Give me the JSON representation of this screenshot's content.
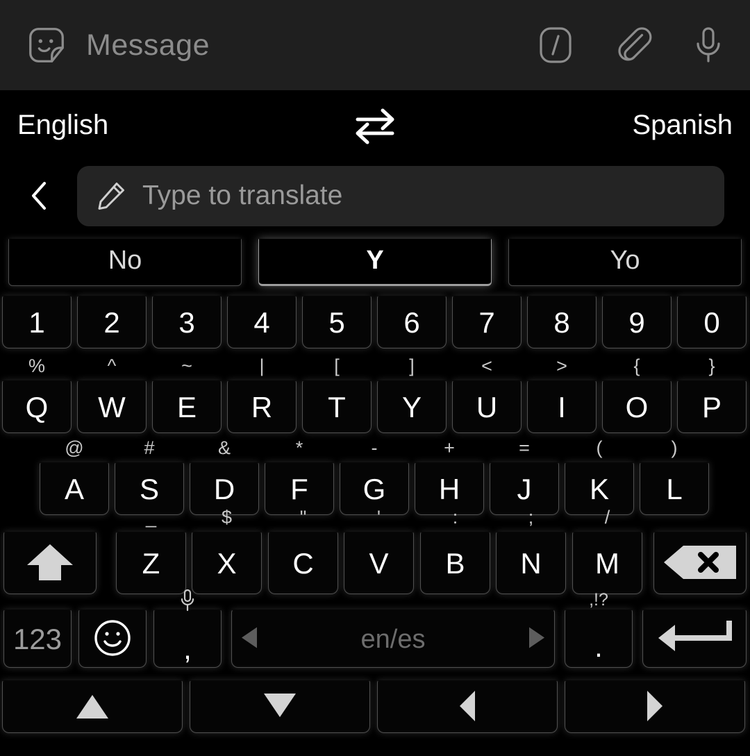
{
  "message_bar": {
    "sticker_icon": "sticker-smiley-icon",
    "label": "Message",
    "actions": [
      {
        "icon": "slash-command-icon",
        "name": "slash-command-button"
      },
      {
        "icon": "paperclip-icon",
        "name": "attach-button"
      },
      {
        "icon": "microphone-icon",
        "name": "voice-record-button"
      }
    ]
  },
  "translate": {
    "source_language": "English",
    "target_language": "Spanish",
    "swap_icon": "swap-arrows-icon",
    "back_icon": "chevron-left-icon",
    "pencil_icon": "pencil-icon",
    "input_value": "",
    "input_placeholder": "Type to translate"
  },
  "suggestions": [
    {
      "label": "No",
      "active": false
    },
    {
      "label": "Y",
      "active": true
    },
    {
      "label": "Yo",
      "active": false
    }
  ],
  "keyboard": {
    "language_label": "en/es",
    "rows": {
      "numbers": [
        "1",
        "2",
        "3",
        "4",
        "5",
        "6",
        "7",
        "8",
        "9",
        "0"
      ],
      "top": [
        {
          "main": "Q",
          "sub": "%"
        },
        {
          "main": "W",
          "sub": "^"
        },
        {
          "main": "E",
          "sub": "~"
        },
        {
          "main": "R",
          "sub": "|"
        },
        {
          "main": "T",
          "sub": "["
        },
        {
          "main": "Y",
          "sub": "]"
        },
        {
          "main": "U",
          "sub": "<"
        },
        {
          "main": "I",
          "sub": ">"
        },
        {
          "main": "O",
          "sub": "{"
        },
        {
          "main": "P",
          "sub": "}"
        }
      ],
      "home": [
        {
          "main": "A",
          "sub": "@"
        },
        {
          "main": "S",
          "sub": "#"
        },
        {
          "main": "D",
          "sub": "&"
        },
        {
          "main": "F",
          "sub": "*"
        },
        {
          "main": "G",
          "sub": "-"
        },
        {
          "main": "H",
          "sub": "+"
        },
        {
          "main": "J",
          "sub": "="
        },
        {
          "main": "K",
          "sub": "("
        },
        {
          "main": "L",
          "sub": ")"
        }
      ],
      "bottom_letters": [
        {
          "main": "Z",
          "sub": "_"
        },
        {
          "main": "X",
          "sub": "$"
        },
        {
          "main": "C",
          "sub": "\""
        },
        {
          "main": "V",
          "sub": "'"
        },
        {
          "main": "B",
          "sub": ":"
        },
        {
          "main": "N",
          "sub": ";"
        },
        {
          "main": "M",
          "sub": "/"
        }
      ],
      "shift_key": {
        "icon": "shift-arrow-icon",
        "name": "shift-key"
      },
      "backspace_key": {
        "icon": "backspace-icon",
        "name": "backspace-key"
      },
      "numeric_key": {
        "label": "123",
        "name": "numeric-mode-key"
      },
      "emoji_key": {
        "icon": "emoji-smiley-icon",
        "name": "emoji-key"
      },
      "comma_key": {
        "main": ",",
        "sub_icon": "microphone-icon",
        "name": "comma-key"
      },
      "period_key": {
        "main": ".",
        "sub": ",!?",
        "name": "period-key"
      },
      "enter_key": {
        "icon": "enter-arrow-icon",
        "name": "enter-key"
      },
      "space_prev_icon": "triangle-left-icon",
      "space_next_icon": "triangle-right-icon"
    },
    "nav_row": [
      {
        "icon": "arrow-up-icon",
        "name": "cursor-up-key"
      },
      {
        "icon": "arrow-down-icon",
        "name": "cursor-down-key"
      },
      {
        "icon": "arrow-left-icon",
        "name": "cursor-left-key"
      },
      {
        "icon": "arrow-right-icon",
        "name": "cursor-right-key"
      }
    ]
  },
  "colors": {
    "message_bar_bg": "#1f1f1f",
    "keyboard_bg": "#000000",
    "key_glow": "#ffffff",
    "input_bg": "#242424",
    "placeholder": "#9a9a9a"
  }
}
